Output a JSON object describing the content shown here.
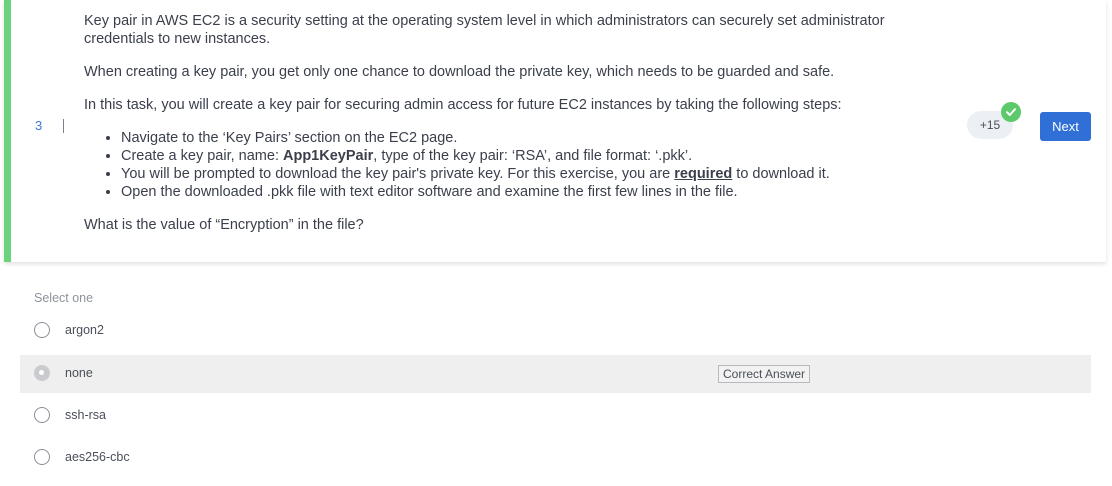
{
  "question": {
    "number": "3",
    "intro": "Key pair in AWS EC2 is a security setting at the operating system level in which administrators can securely set administrator credentials to new instances.",
    "paragraph2": "When creating a key pair, you get only one chance to download the private key, which needs to be guarded and safe.",
    "paragraph3": "In this task, you will create a key pair for securing admin access for future EC2 instances by taking the following steps:",
    "steps": {
      "step1": "Navigate to the ‘Key Pairs’ section on the EC2 page.",
      "step2_pre": "Create a key pair, name: ",
      "step2_bold": "App1KeyPair",
      "step2_post": ", type of the key pair: ‘RSA’, and file format: ‘.pkk’.",
      "step3_pre": "You will be prompted to download the key pair's private key. For this exercise, you are ",
      "step3_bold": "required",
      "step3_post": " to download it.",
      "step4": "Open the downloaded .pkk file with text editor software and examine the first few lines in the file."
    },
    "prompt": "What is the value of “Encryption” in the file?"
  },
  "points": "+15",
  "next_label": "Next",
  "select_label": "Select one",
  "options": [
    {
      "label": "argon2"
    },
    {
      "label": "none",
      "tag": "Correct Answer"
    },
    {
      "label": "ssh-rsa"
    },
    {
      "label": "aes256-cbc"
    }
  ],
  "colors": {
    "accent_bar": "#6bd37b",
    "next_button": "#2f6fd6",
    "check": "#5cc96a",
    "question_number": "#3b7bd6"
  }
}
